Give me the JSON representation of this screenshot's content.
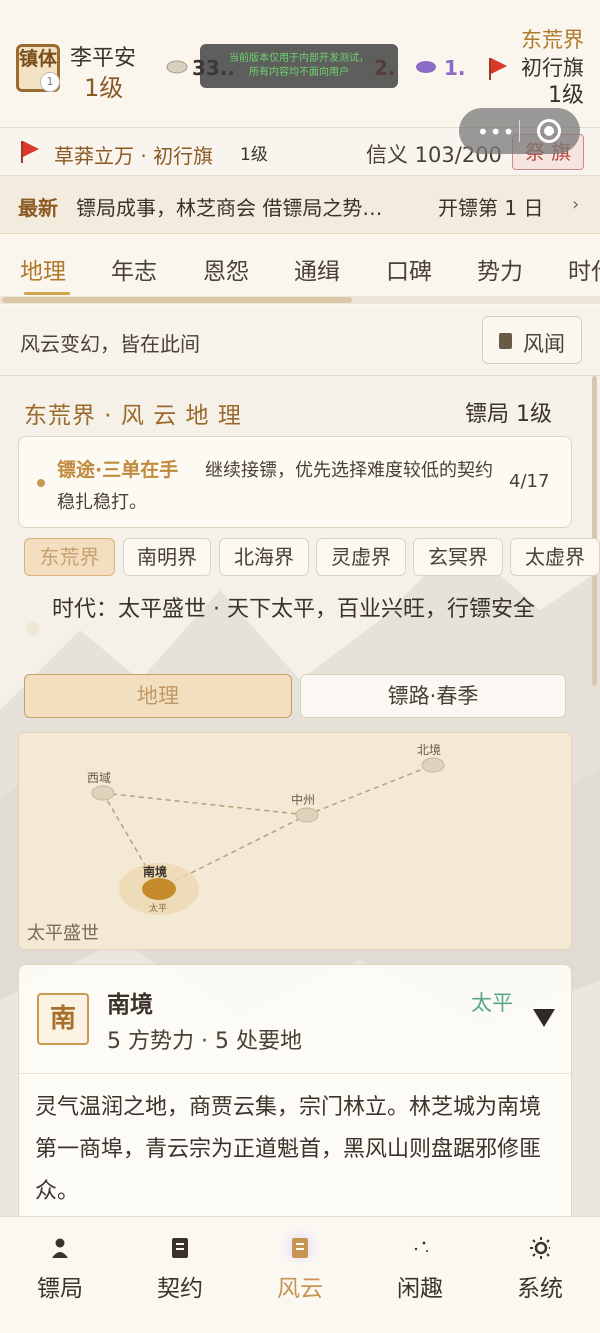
{
  "player": {
    "seal": "镇体",
    "seal_badge": "1",
    "name": "李平安",
    "level": "1级"
  },
  "resources": [
    {
      "icon": "cloud-coin-icon",
      "value": "33..",
      "color": "#3b332b"
    },
    {
      "icon": "red-item-icon",
      "value": "2.",
      "color": "#b8473a"
    },
    {
      "icon": "purple-cloud-icon",
      "value": "1.",
      "color": "#8a6cc8"
    }
  ],
  "dev_toast": {
    "line1": "当前版本仅用于内部开发测试，",
    "line2": "所有内容均不面向用户"
  },
  "realm_badge": {
    "realm": "东荒界",
    "banner": "初行旗",
    "level": "1级"
  },
  "banner_row": {
    "name": "草莽立万 · 初行旗",
    "level": "1级",
    "xinyi": "信义 103/200",
    "jiqi_label": "祭 旗"
  },
  "news": {
    "tag": "最新",
    "text": "镖局成事，林芝商会 借镖局之势…",
    "day": "开镖第  1  日"
  },
  "tabs": [
    "地理",
    "年志",
    "恩怨",
    "通缉",
    "口碑",
    "势力",
    "时代"
  ],
  "subhead": {
    "text": "风云变幻，皆在此间",
    "button": "风闻"
  },
  "realm_header": {
    "title": "东荒界 · 风 云 地 理",
    "level": "镖局  1级"
  },
  "tip": {
    "title": "镖途·三单在手",
    "body": "继续接镖，优先选择难度较低的契约稳扎稳打。",
    "count": "4/17"
  },
  "realms": [
    "东荒界",
    "南明界",
    "北海界",
    "灵虚界",
    "玄冥界",
    "太虚界"
  ],
  "era_text": "时代：太平盛世 · 天下太平，百业兴旺，行镖安全",
  "segments": [
    "地理",
    "镖路·春季"
  ],
  "map": {
    "era_label": "太平盛世",
    "nodes": [
      {
        "name": "西域",
        "status": ""
      },
      {
        "name": "中州",
        "status": ""
      },
      {
        "name": "北境",
        "status": ""
      },
      {
        "name": "南境",
        "status": "太平",
        "selected": true
      }
    ]
  },
  "region": {
    "seal": "南",
    "name": "南境",
    "sub": "5 方势力 · 5 处要地",
    "status": "太平",
    "desc": "灵气温润之地，商贾云集，宗门林立。林芝城为南境第一商埠，青云宗为正道魁首，黑风山则盘踞邪修匪众。"
  },
  "bottom_nav": [
    "镖局",
    "契约",
    "风云",
    "闲趣",
    "系统"
  ],
  "colors": {
    "accent": "#b07a2e",
    "peace": "#5aa888",
    "danger": "#b8473a"
  }
}
